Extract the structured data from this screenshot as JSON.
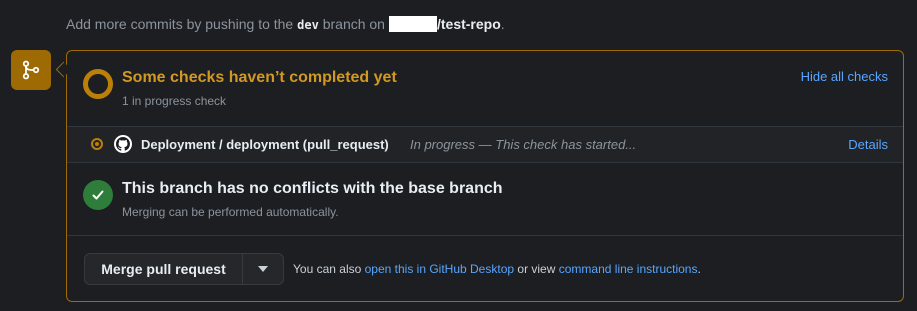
{
  "top_note": {
    "prefix": "Add more commits by pushing to the",
    "branch": "dev",
    "middle": "branch on",
    "repo": "/test-repo",
    "suffix": "."
  },
  "checks": {
    "title": "Some checks haven’t completed yet",
    "subtitle": "1 in progress check",
    "toggle_label": "Hide all checks",
    "items": [
      {
        "name": "Deployment / deployment (pull_request)",
        "status": "In progress — This check has started...",
        "details_label": "Details"
      }
    ]
  },
  "conflicts": {
    "title": "This branch has no conflicts with the base branch",
    "subtitle": "Merging can be performed automatically."
  },
  "merge": {
    "button_label": "Merge pull request",
    "note_prefix": "You can also",
    "desktop_link": "open this in GitHub Desktop",
    "note_middle": "or view",
    "cli_link": "command line instructions",
    "note_suffix": "."
  },
  "colors": {
    "accent_pending": "#d29922",
    "accent_success": "#2f7d3a",
    "link": "#58a6ff"
  },
  "icons": {
    "merge_icon": "git-merge-icon",
    "pending_icon": "pending-ring-icon",
    "check_status_icon": "in-progress-dot-icon",
    "app_logo": "github-logo-icon",
    "success_icon": "check-icon",
    "caret_icon": "triangle-down-icon"
  }
}
